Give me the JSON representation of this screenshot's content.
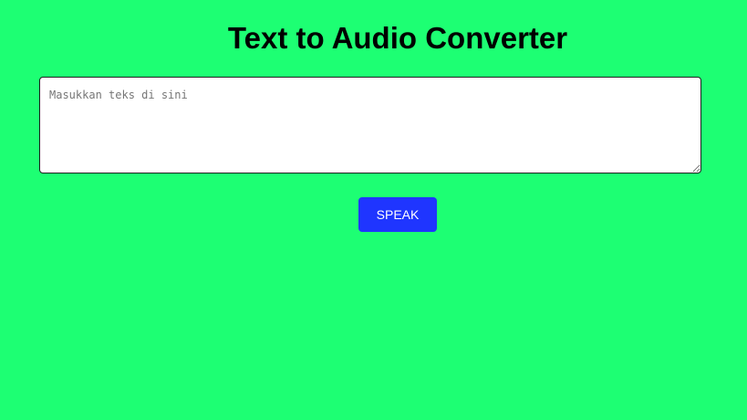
{
  "page": {
    "title": "Text to Audio Converter",
    "background_color": "#1dff73"
  },
  "text_input": {
    "value": "",
    "placeholder": "Masukkan teks di sini"
  },
  "speak_button": {
    "label": "SPEAK",
    "color": "#1f35ff"
  }
}
